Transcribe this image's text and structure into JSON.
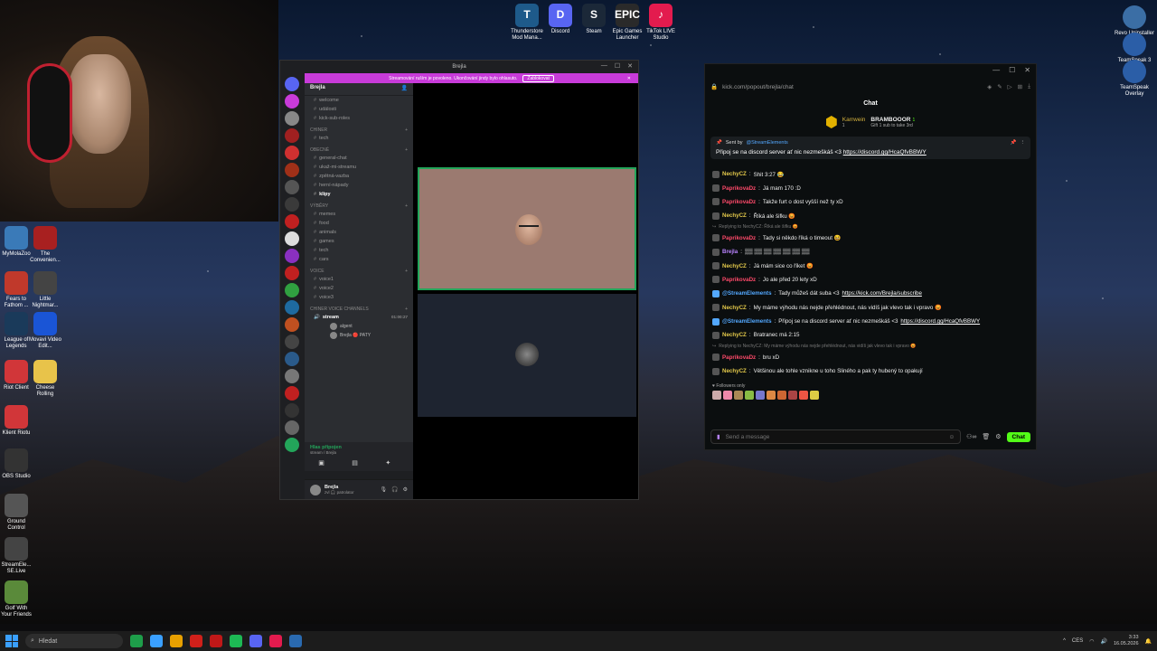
{
  "desktop": {
    "top_icons": [
      {
        "label": "Thunderstore Mod Mana...",
        "color": "#1e5a8a"
      },
      {
        "label": "Discord",
        "color": "#5865f2"
      },
      {
        "label": "Steam",
        "color": "#1b2838"
      },
      {
        "label": "Epic Games Launcher",
        "color": "#2a2a2a"
      },
      {
        "label": "TikTok LIVE Studio",
        "color": "#e31b4e"
      }
    ],
    "top_icon_glyphs": [
      "T",
      "D",
      "S",
      "EPIC",
      "♪"
    ],
    "right_icons": [
      {
        "label": "Revo Uninstaller ...",
        "color": "#3b6ea5"
      },
      {
        "label": "TeamSpeak 3 Client",
        "color": "#2b5ea7"
      },
      {
        "label": "TeamSpeak Overlay",
        "color": "#2b5ea7"
      }
    ],
    "left_icons": [
      {
        "label": "MyMolaZoo",
        "color": "#3a7ab8"
      },
      {
        "label": "The Convenien...",
        "color": "#a82020"
      },
      {
        "label": "Fears to Fathom ...",
        "color": "#c0392b"
      },
      {
        "label": "Little Nightmar...",
        "color": "#444"
      },
      {
        "label": "League of Legends",
        "color": "#1a3a5a"
      },
      {
        "label": "Movavi Video Edit...",
        "color": "#1a55d6"
      },
      {
        "label": "Riot Client",
        "color": "#d13639"
      },
      {
        "label": "Cheese Rolling",
        "color": "#e8c34a"
      },
      {
        "label": "Klient Riotu",
        "color": "#d13639"
      },
      {
        "label": "OBS Studio",
        "color": "#333"
      },
      {
        "label": "Ground Control",
        "color": "#555"
      },
      {
        "label": "StreamEle... SE.Live",
        "color": "#444"
      },
      {
        "label": "Golf With Your Friends",
        "color": "#5a8a3a"
      }
    ]
  },
  "discord": {
    "title": "Brejla",
    "banner_text": "Streamování ruším je povoleno. Ukončování jindy bylo ohlasuto.",
    "banner_button": "Zablokovat",
    "server_name": "Brejla",
    "channel_groups": [
      {
        "category": "",
        "channels": [
          "welcome",
          "události",
          "kick-sub-roles"
        ]
      },
      {
        "category": "CHINER",
        "channels": [
          "tech"
        ]
      },
      {
        "category": "OBECNÉ",
        "channels": [
          "general-chat",
          "ukaž-mi-streamu",
          "zpětná-vazba",
          "herní-nápady",
          "klipy"
        ]
      },
      {
        "category": "VÝBĚRY",
        "channels": [
          "memes",
          "food",
          "animals",
          "games",
          "tech",
          "cars"
        ]
      },
      {
        "category": "VOICE",
        "channels": [
          "voice1",
          "voice2",
          "voice3"
        ]
      }
    ],
    "voice_category": "CHINER VOICE CHANNELS",
    "voice_channel": "stream",
    "voice_timer": "01:00:27",
    "voice_members": [
      "algent",
      "Brejla 🔴 PATY"
    ],
    "voice_status": "Hlas připojen",
    "voice_sub": "stream / Brejla",
    "user_name": "Brejla",
    "user_status": "zvl 🎧 patrolator"
  },
  "kick": {
    "url": "kick.com/popout/brejla/chat",
    "heading": "Chat",
    "gifter": "Karrwein",
    "gifter_count": "1",
    "gift_top": "BRAMBOOOR",
    "gift_top_count": "1",
    "gift_sub": "Gift 1 sub to take 3rd",
    "pinned_sender_prefix": "Sent by",
    "pinned_sender": "@StreamElements",
    "pinned_text": "Připoj se na discord server ať nic nezmeškáš <3 ",
    "pinned_link": "https://discord.gg/HcaQfvBBWY",
    "messages": [
      {
        "user": "NechyCZ",
        "color": "#e2c84a",
        "text": "Shit 3:27 😂"
      },
      {
        "user": "PaprikovaDz",
        "color": "#ff4a6a",
        "text": "Já mam 170 :D"
      },
      {
        "user": "PaprikovaDz",
        "color": "#ff4a6a",
        "text": "Takže furt o dost vyšší než ty xD"
      },
      {
        "user": "NechyCZ",
        "color": "#e2c84a",
        "text": "Říká ale šifku 😡"
      },
      {
        "reply": "Replying to NechyCZ: Říká ale šifku 😡"
      },
      {
        "user": "PaprikovaDz",
        "color": "#ff4a6a",
        "text": "Tady si někdo říká o timeout 😆"
      },
      {
        "user": "Brejla",
        "color": "#b983ff",
        "text": "▒▒ ▒▒ ▒▒ ▒▒ ▒▒ ▒▒ ▒▒"
      },
      {
        "user": "NechyCZ",
        "color": "#e2c84a",
        "text": "Já mám sice co říket 😡"
      },
      {
        "user": "PaprikovaDz",
        "color": "#ff4a6a",
        "text": "Jo ale před 20 lety xD"
      },
      {
        "user": "@StreamElements",
        "color": "#53a8ff",
        "text": "Tady můžeš dát suba <3 ",
        "link": "https://kick.com/Brejla/subscribe"
      },
      {
        "user": "NechyCZ",
        "color": "#e2c84a",
        "text": "My máme výhodu nás nejde přehlédnout, nás vidíš jak vlevo tak i vpravo 😡"
      },
      {
        "user": "@StreamElements",
        "color": "#53a8ff",
        "text": "Připoj se na discord server ať nic nezmeškáš <3 ",
        "link": "https://discord.gg/HcaQfvBBWY"
      },
      {
        "user": "NechyCZ",
        "color": "#e2c84a",
        "text": "Bratranec má 2:15"
      },
      {
        "reply": "Replying to NechyCZ: My máme výhodu nás nejde přehlédnout, nás vidíš jak vlevo tak i vpravo 😡"
      },
      {
        "user": "PaprikovaDz",
        "color": "#ff4a6a",
        "text": "bru xD"
      },
      {
        "user": "NechyCZ",
        "color": "#e2c84a",
        "text": "Většinou ale tohle vznikne u toho Sliného a pak ty hubený to opakují"
      }
    ],
    "followers_only": "Followers only",
    "input_placeholder": "Send a message",
    "chat_button": "Chat"
  },
  "taskbar": {
    "search_placeholder": "Hledat",
    "lang": "CES",
    "time": "3:33",
    "date": "16.05.2026",
    "apps": [
      "#1e9e4a",
      "#3aa0ff",
      "#e8a000",
      "#d0201a",
      "#c01818",
      "#1db954",
      "#5865f2",
      "#e31b4e",
      "#2a6ab0"
    ]
  }
}
